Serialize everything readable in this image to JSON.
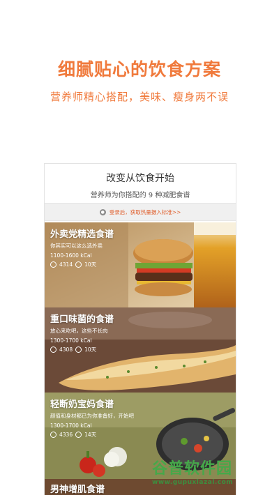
{
  "headline": "细腻贴心的饮食方案",
  "subline": "营养师精心搭配，美味、瘦身两不误",
  "card": {
    "title": "改变从饮食开始",
    "subtitle": "营养师为你搭配的 9 种减肥食谱",
    "login_prompt": "登录后，获取热量摄入标准>>"
  },
  "plans": [
    {
      "name": "外卖党精选食谱",
      "tagline": "你其实可以这么选外卖",
      "kcal": "1100-1600 kCal",
      "count": "4314",
      "duration": "10天"
    },
    {
      "name": "重口味菌的食谱",
      "tagline": "放心来吃吧，这些不长肉",
      "kcal": "1300-1700 kCal",
      "count": "4308",
      "duration": "10天"
    },
    {
      "name": "轻断奶宝妈食谱",
      "tagline": "颜值和身材都已为你准备好，开始吧",
      "kcal": "1300-1700 kCal",
      "count": "4336",
      "duration": "14天"
    },
    {
      "name": "男神增肌食谱"
    }
  ],
  "watermark": {
    "name": "谷普软件园",
    "url": "www.gupuxlazal.com"
  },
  "colors": {
    "accent": "#f07a3c",
    "watermark": "#46a84a"
  }
}
